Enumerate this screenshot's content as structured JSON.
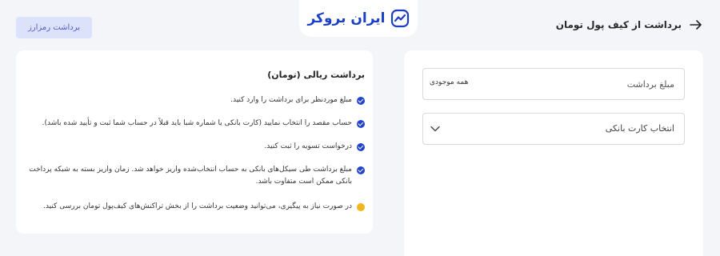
{
  "header": {
    "back_label": "برداشت از کیف پول تومان",
    "logo_text": "ایران بروکر",
    "crypto_withdraw_label": "برداشت رمزارز"
  },
  "form": {
    "amount_placeholder": "مبلغ برداشت",
    "all_balance_label": "همه موجودی",
    "bank_card_placeholder": "انتخاب کارت بانکی"
  },
  "info": {
    "title": "برداشت ریالی (تومان)",
    "items": [
      {
        "text": "مبلغ موردنظر برای برداشت را وارد کنید.",
        "type": "check"
      },
      {
        "text": "حساب مقصد را انتخاب نمایید (کارت بانکی یا شماره شبا باید قبلاً در حساب شما ثبت و تأیید شده باشد).",
        "type": "check"
      },
      {
        "text": "درخواست تسویه را ثبت کنید.",
        "type": "check"
      },
      {
        "text": "مبلغ برداشت طی سیکل‌های بانکی به حساب انتخاب‌شده واریز خواهد شد. زمان واریز بسته به شبکه پرداخت بانکی ممکن است متفاوت باشد.",
        "type": "check"
      },
      {
        "text": "در صورت نیاز به پیگیری، می‌توانید وضعیت برداشت را از بخش تراکنش‌های کیف‌پول تومان بررسی کنید.",
        "type": "note"
      }
    ]
  },
  "icons": {
    "back": "arrow-right-icon",
    "logo": "chart-check-icon",
    "select": "chevron-down-icon",
    "bullet": "check-circle-icon",
    "note": "yellow-dot-icon"
  },
  "colors": {
    "brand": "#1b3fc4",
    "crypto_button_bg": "#dde2fb",
    "bullet_blue": "#2244cc",
    "note_yellow": "#f2b51c",
    "page_bg": "#f4f5f8"
  }
}
